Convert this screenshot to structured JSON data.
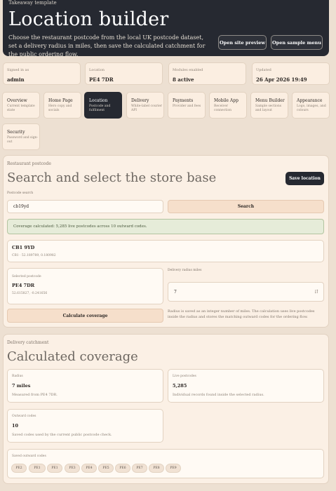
{
  "hero": {
    "kicker": "Takeaway template",
    "title": "Location builder",
    "description": "Choose the restaurant postcode from the local UK postcode dataset, set a delivery radius in miles, then save the calculated catchment for the public ordering flow.",
    "preview_button": "Open site preview",
    "sample_menu_button": "Open sample menu"
  },
  "stats": [
    {
      "label": "Signed in as",
      "value": "admin"
    },
    {
      "label": "Location",
      "value": "PE4 7DR"
    },
    {
      "label": "Modules enabled",
      "value": "8 active"
    },
    {
      "label": "Updated",
      "value": "26 Apr 2026 19:49"
    }
  ],
  "nav": [
    {
      "title": "Overview",
      "subtitle": "Current template state"
    },
    {
      "title": "Home Page",
      "subtitle": "Hero copy and socials"
    },
    {
      "title": "Location",
      "subtitle": "Postcode and fulfilment"
    },
    {
      "title": "Delivery",
      "subtitle": "White-label courier API"
    },
    {
      "title": "Payments",
      "subtitle": "Provider and fees"
    },
    {
      "title": "Mobile App",
      "subtitle": "Receiver connection"
    },
    {
      "title": "Menu Builder",
      "subtitle": "Sample sections and layout"
    },
    {
      "title": "Appearance",
      "subtitle": "Logo, images, and colours"
    },
    {
      "title": "Security",
      "subtitle": "Password and sign-out"
    }
  ],
  "postcode_panel": {
    "eyebrow": "Restaurant postcode",
    "title": "Search and select the store base",
    "save_button": "Save location",
    "search_label": "Postcode search",
    "search_value": "cb19yd",
    "search_button": "Search",
    "coverage_message": "Coverage calculated: 5,285 live postcodes across 10 outward codes.",
    "result_postcode": "CB1 9YD",
    "result_detail": "CB1 · 52.189789, 0.180982",
    "selected_label": "Selected postcode",
    "selected_value": "PE4 7DR",
    "selected_coords": "52.615827, -0.241656",
    "radius_label": "Delivery radius miles",
    "radius_value": "7",
    "calculate_button": "Calculate coverage",
    "radius_help": "Radius is saved as an integer number of miles. The calculation uses live postcodes inside the radius and stores the matching outward codes for the ordering flow."
  },
  "catchment_panel": {
    "eyebrow": "Delivery catchment",
    "title": "Calculated coverage",
    "radius_label": "Radius",
    "radius_value": "7 miles",
    "radius_note": "Measured from PE4 7DR.",
    "live_label": "Live postcodes",
    "live_value": "5,285",
    "live_note": "Individual records found inside the selected radius.",
    "outward_label": "Outward codes",
    "outward_value": "10",
    "outward_note": "Saved codes used by the current public postcode check.",
    "saved_label": "Saved outward codes",
    "codes": [
      "PE2",
      "PE1",
      "PE1",
      "PE3",
      "PE4",
      "PE5",
      "PE6",
      "PE7",
      "PE8",
      "PE9"
    ]
  },
  "colors": {
    "background": "#ede0d2",
    "hero": "#262931",
    "card": "#fbf0e5",
    "accent_peach": "#f6dfcb",
    "success_bg": "#e6ecd9"
  }
}
